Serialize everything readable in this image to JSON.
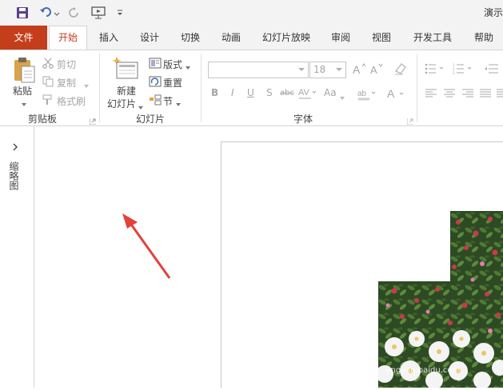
{
  "app": {
    "title": "演示"
  },
  "tabs": [
    {
      "label": "文件"
    },
    {
      "label": "开始"
    },
    {
      "label": "插入"
    },
    {
      "label": "设计"
    },
    {
      "label": "切换"
    },
    {
      "label": "动画"
    },
    {
      "label": "幻灯片放映"
    },
    {
      "label": "审阅"
    },
    {
      "label": "视图"
    },
    {
      "label": "开发工具"
    },
    {
      "label": "帮助"
    }
  ],
  "clipboard": {
    "paste": "粘贴",
    "cut": "剪切",
    "copy": "复制",
    "format_painter": "格式刷",
    "group": "剪贴板"
  },
  "slides": {
    "new_slide_line1": "新建",
    "new_slide_line2": "幻灯片",
    "layout": "版式",
    "reset": "重置",
    "section": "节",
    "group": "幻灯片"
  },
  "font": {
    "size": "18",
    "group": "字体",
    "abc": "abc",
    "aa": "Aa"
  },
  "left_pane": {
    "label": "缩略图"
  },
  "watermark": {
    "text": "jingyan.baidu.com"
  },
  "colors": {
    "accent": "#c43e1c",
    "toolbar_bg": "#f3f3f3"
  }
}
